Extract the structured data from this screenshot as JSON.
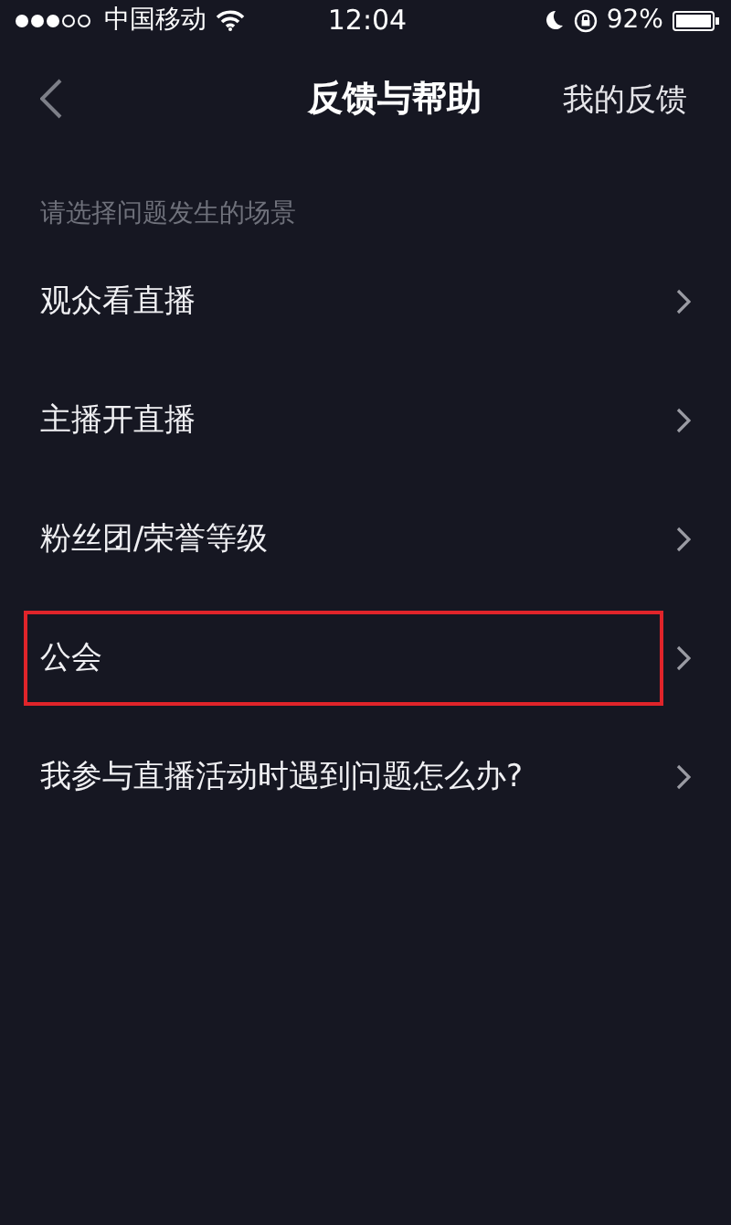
{
  "status_bar": {
    "carrier": "中国移动",
    "time": "12:04",
    "battery": "92%"
  },
  "nav": {
    "title": "反馈与帮助",
    "action": "我的反馈"
  },
  "section": {
    "heading": "请选择问题发生的场景"
  },
  "items": [
    {
      "label": "观众看直播",
      "highlighted": false
    },
    {
      "label": "主播开直播",
      "highlighted": false
    },
    {
      "label": "粉丝团/荣誉等级",
      "highlighted": false
    },
    {
      "label": "公会",
      "highlighted": true
    },
    {
      "label": "我参与直播活动时遇到问题怎么办?",
      "highlighted": false
    }
  ]
}
